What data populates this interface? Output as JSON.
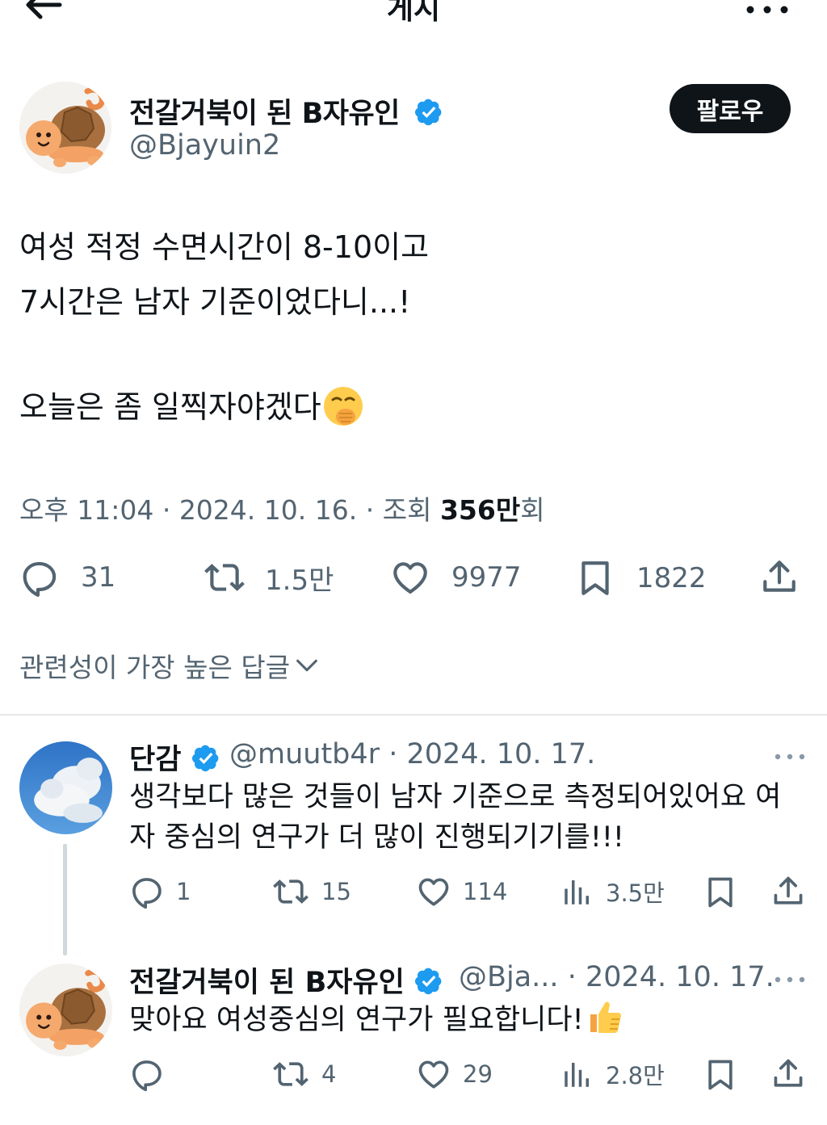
{
  "header": {
    "title": "게시",
    "back_icon": "arrow-left-icon",
    "more_icon": "more-horizontal-icon"
  },
  "post": {
    "author_name": "전갈거북이 된 B자유인",
    "author_handle": "@Bjayuin2",
    "verified": true,
    "follow_label": "팔로우",
    "text_lines": [
      "여성 적정 수면시간이 8-10이고",
      "7시간은 남자 기준이었다니...!",
      "",
      "오늘은 좀 일찍자야겠다"
    ],
    "text_emoji": "face-with-hand-over-mouth-emoji",
    "time": "오후 11:04",
    "date": "2024. 10. 16.",
    "views_label": "조회",
    "views_count": "356만",
    "views_suffix": "회",
    "meta_sep": "·",
    "stats": {
      "replies": "31",
      "reposts": "1.5만",
      "likes": "9977",
      "bookmarks": "1822"
    }
  },
  "sort": {
    "label": "관련성이 가장 높은 답글"
  },
  "replies": [
    {
      "name": "단감",
      "verified": true,
      "handle": "@muutb4r",
      "date": "· 2024. 10. 17.",
      "lines": [
        "생각보다 많은 것들이 남자 기준으로 측정되어있어요 여",
        "자 중심의 연구가 더 많이 진행되기기를!!!"
      ],
      "stats": {
        "replies": "1",
        "reposts": "15",
        "likes": "114",
        "views": "3.5만"
      }
    },
    {
      "name": "전갈거북이 된 B자유인",
      "verified": true,
      "handle": "@Bja...",
      "date": "· 2024. 10. 17.",
      "lines": [
        "맞아요 여성중심의 연구가 필요합니다!"
      ],
      "line_emoji": "thumbs-up-emoji",
      "stats": {
        "replies": "",
        "reposts": "4",
        "likes": "29",
        "views": "2.8만"
      }
    }
  ],
  "colors": {
    "text": "#0f1419",
    "secondary": "#536471",
    "verified": "#1d9bf0",
    "follow_bg": "#0f1419"
  }
}
